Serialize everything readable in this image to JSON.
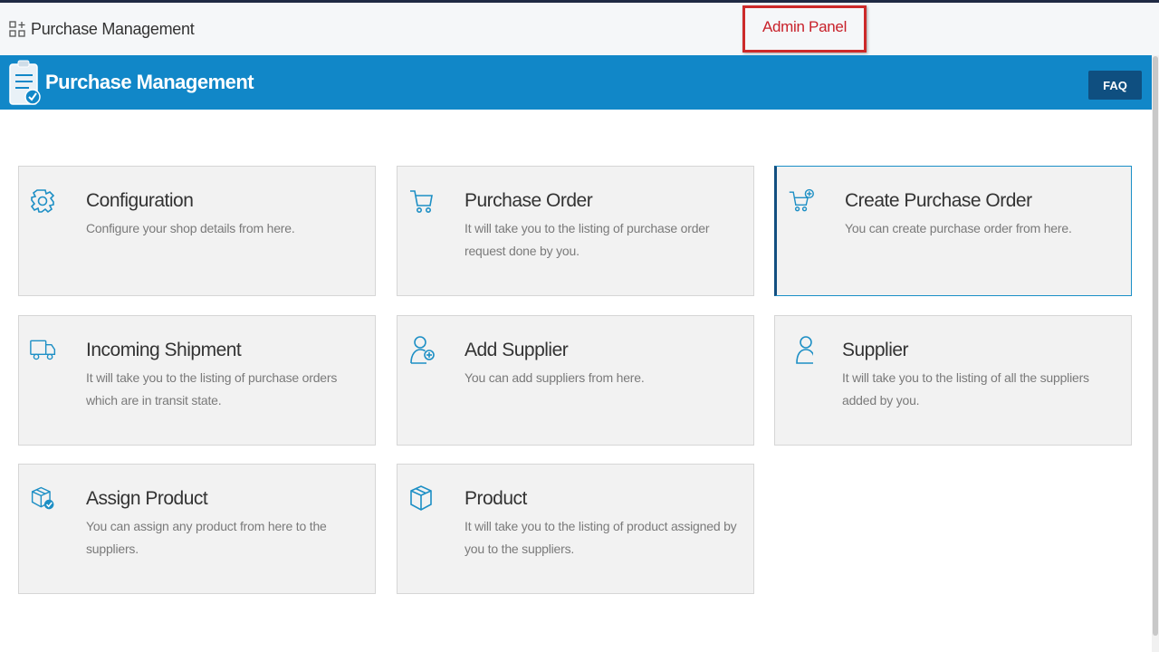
{
  "topbar": {
    "title": "Purchase Management",
    "icon": "apps-grid-icon"
  },
  "annotation": {
    "label": "Admin Panel",
    "color": "#c8212a"
  },
  "banner": {
    "title": "Purchase Management",
    "faq_label": "FAQ",
    "color": "#1187c8"
  },
  "tiles": [
    {
      "title": "Configuration",
      "description": "Configure your shop details from here.",
      "icon": "gear-icon"
    },
    {
      "title": "Purchase Order",
      "description": "It will take you to the listing of purchase order request done by you.",
      "icon": "cart-icon"
    },
    {
      "title": "Create Purchase Order",
      "description": "You can create purchase order from here.",
      "icon": "cart-plus-icon",
      "selected": true
    },
    {
      "title": "Incoming Shipment",
      "description": "It will take you to the listing of purchase orders which are in transit state.",
      "icon": "truck-icon"
    },
    {
      "title": "Add Supplier",
      "description": "You can add suppliers from here.",
      "icon": "user-plus-icon"
    },
    {
      "title": "Supplier",
      "description": "It will take you to the listing of all the suppliers added by you.",
      "icon": "user-icon"
    },
    {
      "title": "Assign Product",
      "description": "You can assign any product from here to the suppliers.",
      "icon": "box-check-icon"
    },
    {
      "title": "Product",
      "description": "It will take you to the listing of product assigned by you to the suppliers.",
      "icon": "box-icon"
    }
  ]
}
